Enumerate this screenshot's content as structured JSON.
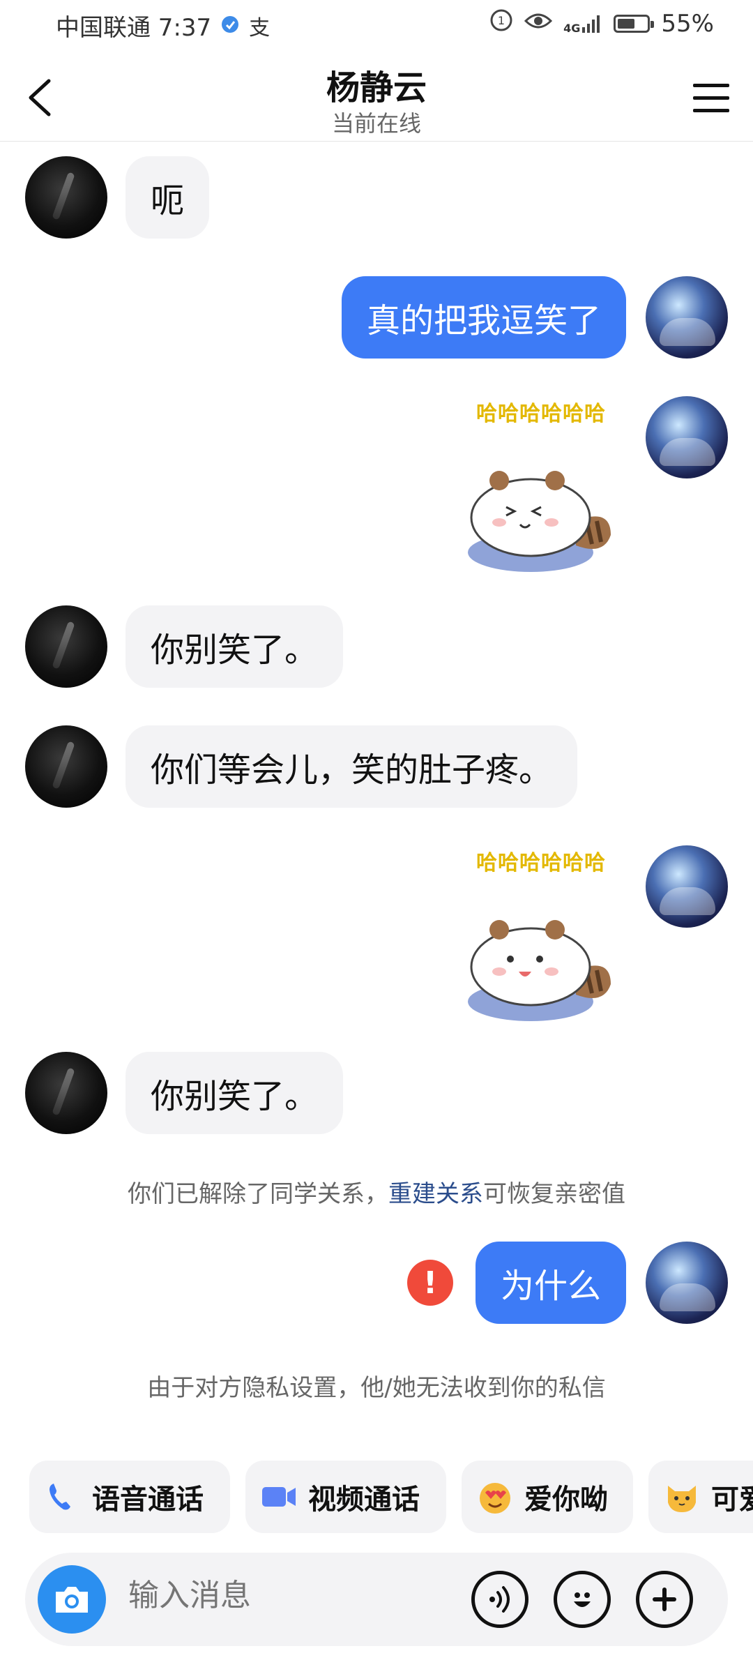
{
  "status_bar": {
    "carrier_time": "中国联通 7:37",
    "extra_glyph": "支",
    "network": "4G",
    "battery": "55%"
  },
  "header": {
    "title": "杨静云",
    "subtitle": "当前在线"
  },
  "messages": [
    {
      "side": "left",
      "text": "呃"
    },
    {
      "side": "right",
      "text": "真的把我逗笑了"
    },
    {
      "side": "right",
      "sticker_caption": "哈哈哈哈哈哈"
    },
    {
      "side": "left",
      "text": "你别笑了。"
    },
    {
      "side": "left",
      "text": "你们等会儿，笑的肚子疼。"
    },
    {
      "side": "right",
      "sticker_caption": "哈哈哈哈哈哈"
    },
    {
      "side": "left",
      "text": "你别笑了。"
    },
    {
      "side": "right",
      "text": "为什么",
      "failed": true,
      "error_mark": "!"
    }
  ],
  "system_notice": {
    "prefix": "你们已解除了同学关系，",
    "link": "重建关系",
    "suffix": "可恢复亲密值"
  },
  "privacy_notice": "由于对方隐私设置，他/她无法收到你的私信",
  "quick_actions": [
    {
      "label": "语音通话",
      "icon": "phone-icon"
    },
    {
      "label": "视频通话",
      "icon": "video-icon"
    },
    {
      "label": "爱你呦",
      "icon": "heart-eyes-emoji-icon"
    },
    {
      "label": "可爱",
      "icon": "cat-emoji-icon"
    }
  ],
  "input": {
    "placeholder": "输入消息"
  },
  "colors": {
    "accent": "#3d7bf6",
    "error": "#f04a3a",
    "camera": "#2b8ff0"
  }
}
